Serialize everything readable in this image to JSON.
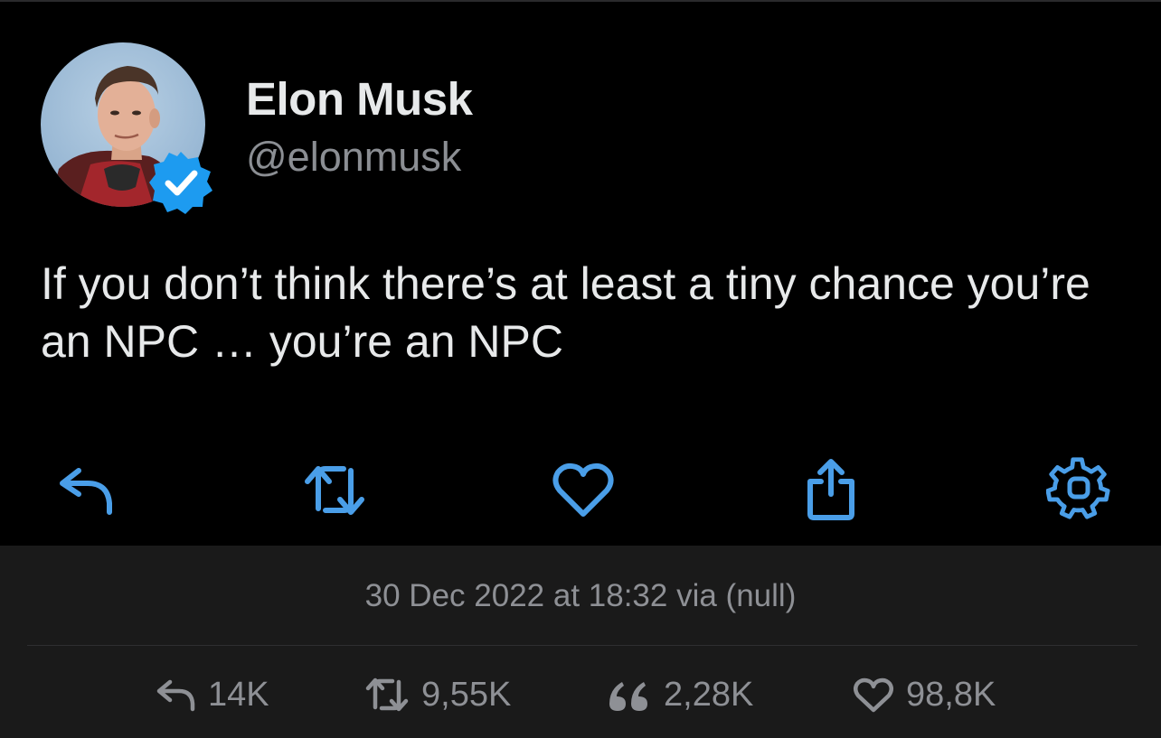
{
  "user": {
    "display_name": "Elon Musk",
    "handle": "@elonmusk",
    "verified": true
  },
  "tweet": {
    "text": "If you don’t think there’s at least a tiny chance you’re an NPC … you’re an NPC",
    "timestamp": "30 Dec 2022 at 18:32 via (null)"
  },
  "actions": [
    {
      "icon": "reply-icon"
    },
    {
      "icon": "retweet-icon"
    },
    {
      "icon": "heart-icon"
    },
    {
      "icon": "share-icon"
    },
    {
      "icon": "gear-icon"
    }
  ],
  "stats": {
    "replies": "14K",
    "retweets": "9,55K",
    "quotes": "2,28K",
    "likes": "98,8K"
  },
  "colors": {
    "accent": "#4a9ee8",
    "verified": "#1d9bf0",
    "background": "#000000",
    "meta_background": "#1a1a1a",
    "muted_text": "#8e9095"
  }
}
